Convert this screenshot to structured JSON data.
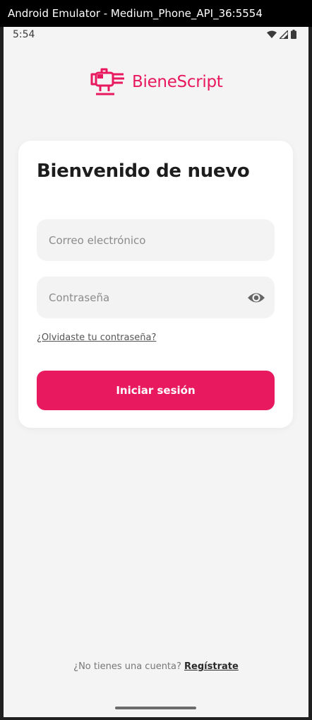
{
  "window": {
    "title": "Android Emulator - Medium_Phone_API_36:5554"
  },
  "status_bar": {
    "time": "5:54",
    "icons": [
      "wifi-icon",
      "signal-icon",
      "battery-icon"
    ]
  },
  "brand": {
    "name": "BieneScript",
    "color": "#e8195e",
    "logo_icon": "robot-hand-icon"
  },
  "login": {
    "title": "Bienvenido de nuevo",
    "email_placeholder": "Correo electrónico",
    "password_placeholder": "Contraseña",
    "password_toggle_icon": "eye-icon",
    "forgot_password": "¿Olvidaste tu contraseña?",
    "submit_label": "Iniciar sesión"
  },
  "signup": {
    "prompt": "¿No tienes una cuenta?",
    "link": "Regístrate"
  }
}
